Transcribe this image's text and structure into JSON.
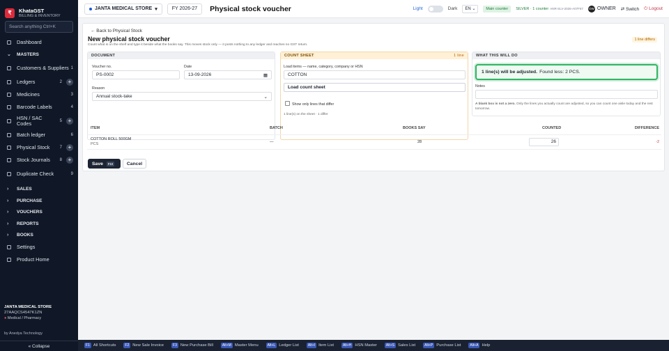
{
  "brand": {
    "name": "KhataGST",
    "subtitle": "BILLING & INVENTORY",
    "search_placeholder": "Search anything  Ctrl+K"
  },
  "sidebar": {
    "dashboard": "Dashboard",
    "masters": "MASTERS",
    "items": [
      {
        "label": "Customers & Suppliers",
        "count": "1",
        "plus": false
      },
      {
        "label": "Ledgers",
        "count": "2",
        "plus": true
      },
      {
        "label": "Medicines",
        "count": "3",
        "plus": false
      },
      {
        "label": "Barcode Labels",
        "count": "4",
        "plus": false
      },
      {
        "label": "HSN / SAC Codes",
        "count": "5",
        "plus": true
      },
      {
        "label": "Batch ledger",
        "count": "6",
        "plus": false
      },
      {
        "label": "Physical Stock",
        "count": "7",
        "plus": true
      },
      {
        "label": "Stock Journals",
        "count": "8",
        "plus": true
      },
      {
        "label": "Duplicate Check",
        "count": "9",
        "plus": false
      }
    ],
    "sections": [
      "SALES",
      "PURCHASE",
      "VOUCHERS",
      "REPORTS",
      "BOOKS"
    ],
    "settings": "Settings",
    "product_home": "Product Home",
    "footer": {
      "store": "JANTA MEDICAL STORE",
      "gstin": "27AAQCS4547K1ZN",
      "type": "Medical / Pharmacy",
      "by": "by Anedya Technology",
      "collapse": "« Collapse"
    }
  },
  "topbar": {
    "store": "JANTA MEDICAL STORE",
    "fy": "FY 2026-27",
    "title": "Physical stock voucher",
    "light": "Light",
    "dark": "Dark",
    "lang": "EN",
    "main_counter": "Main counter",
    "silver": "SILVER · 1 counter",
    "code": "ANR-SLV-2026-A07F67",
    "owner_initials": "OW",
    "owner": "OWNER",
    "switch": "Switch",
    "logout": "Logout"
  },
  "page": {
    "back": "← Back to Physical Stock",
    "title": "New physical stock voucher",
    "desc": "Count what is on the shelf and type it beside what the books say. This moves stock only — it posts nothing to any ledger and reaches no GST return.",
    "differs": "1 line differs",
    "document": {
      "header": "DOCUMENT",
      "voucher_label": "Voucher no.",
      "voucher": "PS-0002",
      "date_label": "Date",
      "date": "13-09-2026",
      "reason_label": "Reason",
      "reason": "Annual stock-take"
    },
    "count_sheet": {
      "header": "COUNT SHEET",
      "lines": "1 line",
      "load_label": "Load items — name, category, company or HSN",
      "load_value": "COTTON",
      "load_btn": "Load count sheet",
      "show_label": "Show only lines that differ",
      "summary": "1 line(s) on the sheet · 1 differ"
    },
    "will_do": {
      "header": "WHAT THIS WILL DO",
      "adjusted": "1 line(s) will be adjusted.",
      "found": "Found less: 2 PCS.",
      "notes_label": "Notes",
      "blank_bold": "A blank box is not a zero.",
      "blank_rest": " Only the lines you actually count are adjusted, so you can count one aisle today and the rest tomorrow."
    },
    "table": {
      "headers": [
        "ITEM",
        "BATCH",
        "BOOKS SAY",
        "COUNTED",
        "DIFFERENCE"
      ],
      "row": {
        "item": "COTTON ROLL 500GM",
        "unit": "PCS",
        "batch": "—",
        "books": "28",
        "counted": "26",
        "diff": "-2"
      }
    },
    "save": "Save",
    "save_key": "F10",
    "cancel": "Cancel"
  },
  "shortcuts": [
    {
      "key": "F1",
      "label": "All Shortcuts"
    },
    {
      "key": "F2",
      "label": "New Sale Invoice"
    },
    {
      "key": "F3",
      "label": "New Purchase Bill"
    },
    {
      "key": "Alt+M",
      "label": "Master Menu"
    },
    {
      "key": "Alt+L",
      "label": "Ledger List"
    },
    {
      "key": "Alt+I",
      "label": "Item List"
    },
    {
      "key": "Alt+H",
      "label": "HSN Master"
    },
    {
      "key": "Alt+S",
      "label": "Sales List"
    },
    {
      "key": "Alt+P",
      "label": "Purchase List"
    },
    {
      "key": "Alt+A",
      "label": "Help"
    }
  ],
  "colors": {
    "accent": "#dc2b3c",
    "sidebar": "#101827",
    "success": "#2fb561",
    "danger": "#c2364a"
  }
}
